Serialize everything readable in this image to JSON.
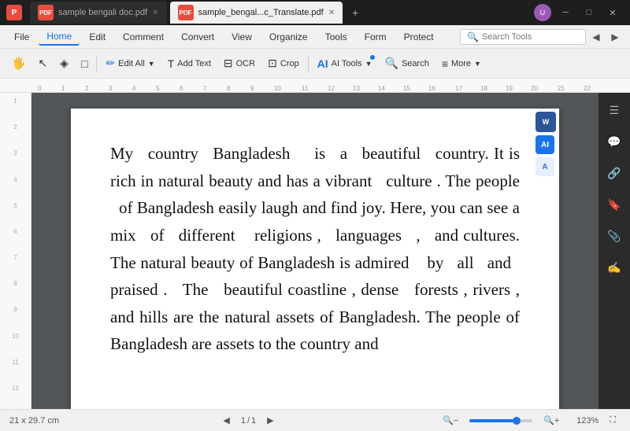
{
  "titlebar": {
    "tab1_label": "sample bengali doc.pdf",
    "tab2_label": "sample_bengal...c_Translate.pdf",
    "new_tab_label": "+",
    "avatar_text": "U",
    "btn_min": "─",
    "btn_max": "□",
    "btn_close": "✕"
  },
  "menubar": {
    "file": "File",
    "home": "Home",
    "edit": "Edit",
    "comment": "Comment",
    "convert": "Convert",
    "view": "View",
    "organize": "Organize",
    "tools": "Tools",
    "form": "Form",
    "protect": "Protect",
    "search_placeholder": "Search Tools"
  },
  "toolbar": {
    "hand": "✋",
    "select": "↖",
    "highlight": "◈",
    "shape": "□",
    "edit_all": "Edit All",
    "add_text": "Add Text",
    "ocr": "OCR",
    "crop": "Crop",
    "ai_tools": "AI Tools",
    "search": "Search",
    "more": "More"
  },
  "statusbar": {
    "dimensions": "21 x 29.7 cm",
    "page_nav": "1",
    "page_total": "1",
    "zoom_percent": "123%"
  },
  "page": {
    "content": "My  country  Bangladesh    is  a  beautiful  country. It is rich in natural beauty and has a vibrant  culture . The people  of Bangladesh easily laugh and find joy. Here, you can see a mix  of  different   religions ,  languages  ,  and cultures. The natural beauty of Bangladesh is admired   by  all  and  praised .  The  beautiful coastline , dense  forests , rivers , and hills are the natural assets of Bangladesh. The people of Bangladesh are assets to the country and"
  },
  "right_sidebar": {
    "panel_icon": "☰",
    "comment_icon": "💬",
    "link_icon": "🔗",
    "bookmark_icon": "🔖",
    "attach_icon": "📎",
    "sign_icon": "✍"
  }
}
